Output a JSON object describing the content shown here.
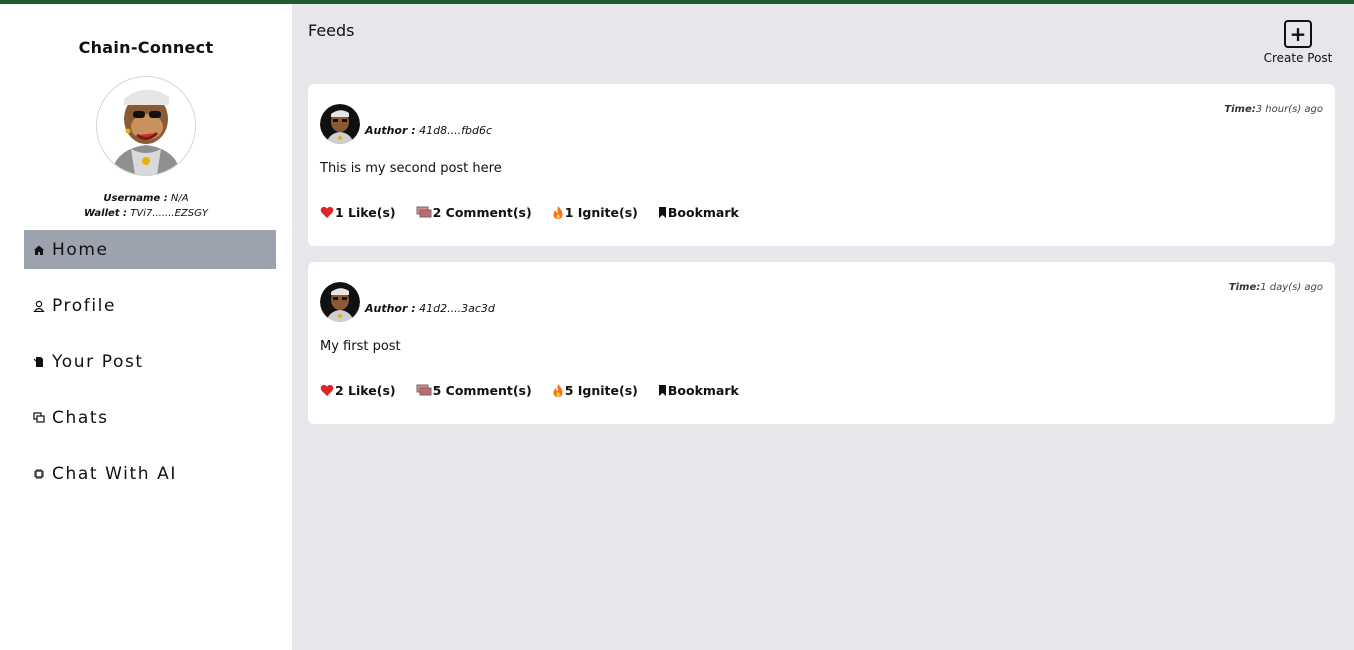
{
  "app": {
    "title": "Chain-Connect"
  },
  "user": {
    "username_label": "Username :",
    "username_value": "N/A",
    "wallet_label": "Wallet :",
    "wallet_value": "TVi7.......EZSGY"
  },
  "nav": [
    {
      "label": "Home",
      "icon": "home-icon",
      "active": true
    },
    {
      "label": "Profile",
      "icon": "user-icon",
      "active": false
    },
    {
      "label": "Your Post",
      "icon": "post-icon",
      "active": false
    },
    {
      "label": "Chats",
      "icon": "chat-icon",
      "active": false
    },
    {
      "label": "Chat With AI",
      "icon": "ai-chip-icon",
      "active": false
    }
  ],
  "main": {
    "title": "Feeds",
    "create_post_label": "Create Post"
  },
  "posts": [
    {
      "author_label": "Author :",
      "author_value": "41d8....fbd6c",
      "time_label": "Time:",
      "time_value": "3 hour(s) ago",
      "content": "This is my second post here",
      "likes": "1 Like(s)",
      "comments": "2 Comment(s)",
      "ignites": "1 Ignite(s)",
      "bookmark": "Bookmark"
    },
    {
      "author_label": "Author :",
      "author_value": "41d2....3ac3d",
      "time_label": "Time:",
      "time_value": "1 day(s) ago",
      "content": "My first post",
      "likes": "2 Like(s)",
      "comments": "5 Comment(s)",
      "ignites": "5 Ignite(s)",
      "bookmark": "Bookmark"
    }
  ],
  "colors": {
    "top_accent": "#1f5a2a",
    "active_nav": "#9ca3af",
    "main_bg": "#e5e7eb",
    "like_heart": "#e02424",
    "ignite_flame": "#f97316"
  }
}
